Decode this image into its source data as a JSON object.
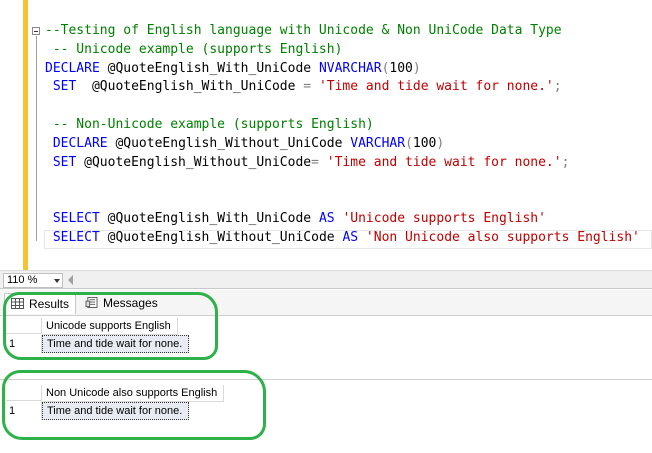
{
  "editor": {
    "lines": [
      [
        {
          "t": "--Testing of English language with Unicode & Non UniCode Data Type",
          "c": "cm"
        }
      ],
      [
        {
          "t": " -- Unicode example (supports English)",
          "c": "cm"
        }
      ],
      [
        {
          "t": "DECLARE ",
          "c": "kw"
        },
        {
          "t": "@QuoteEnglish_With_UniCode ",
          "c": "var"
        },
        {
          "t": "NVARCHAR",
          "c": "kw"
        },
        {
          "t": "(",
          "c": "op"
        },
        {
          "t": "100",
          "c": "var"
        },
        {
          "t": ")",
          "c": "op"
        }
      ],
      [
        {
          "t": " SET  ",
          "c": "kw"
        },
        {
          "t": "@QuoteEnglish_With_UniCode ",
          "c": "var"
        },
        {
          "t": "= ",
          "c": "op"
        },
        {
          "t": "'Time and tide wait for none.'",
          "c": "str"
        },
        {
          "t": ";",
          "c": "op"
        }
      ],
      [
        {
          "t": "",
          "c": "var"
        }
      ],
      [
        {
          "t": " -- Non-Unicode example (supports English)",
          "c": "cm"
        }
      ],
      [
        {
          "t": " DECLARE ",
          "c": "kw"
        },
        {
          "t": "@QuoteEnglish_Without_UniCode ",
          "c": "var"
        },
        {
          "t": "VARCHAR",
          "c": "kw"
        },
        {
          "t": "(",
          "c": "op"
        },
        {
          "t": "100",
          "c": "var"
        },
        {
          "t": ")",
          "c": "op"
        }
      ],
      [
        {
          "t": " SET ",
          "c": "kw"
        },
        {
          "t": "@QuoteEnglish_Without_UniCode",
          "c": "var"
        },
        {
          "t": "= ",
          "c": "op"
        },
        {
          "t": "'Time and tide wait for none.'",
          "c": "str"
        },
        {
          "t": ";",
          "c": "op"
        }
      ],
      [
        {
          "t": "",
          "c": "var"
        }
      ],
      [
        {
          "t": "",
          "c": "var"
        }
      ],
      [
        {
          "t": " SELECT ",
          "c": "kw"
        },
        {
          "t": "@QuoteEnglish_With_UniCode ",
          "c": "var"
        },
        {
          "t": "AS ",
          "c": "kw"
        },
        {
          "t": "'Unicode supports English'",
          "c": "str"
        }
      ],
      [
        {
          "t": " SELECT ",
          "c": "kw"
        },
        {
          "t": "@QuoteEnglish_Without_UniCode ",
          "c": "var"
        },
        {
          "t": "AS ",
          "c": "kw"
        },
        {
          "t": "'Non Unicode also supports English'",
          "c": "str"
        }
      ]
    ]
  },
  "zoom": {
    "value": "110 %"
  },
  "tabs": {
    "results_label": "Results",
    "messages_label": "Messages"
  },
  "results": [
    {
      "column": "Unicode supports English",
      "row_number": "1",
      "value": "Time and tide wait for none."
    },
    {
      "column": "Non Unicode also supports English",
      "row_number": "1",
      "value": "Time and tide wait for none."
    }
  ],
  "colors": {
    "keyword": "#0000ff",
    "string": "#c00000",
    "comment": "#008000",
    "highlight_oval": "#2db24a",
    "change_bar": "#f3c535"
  }
}
